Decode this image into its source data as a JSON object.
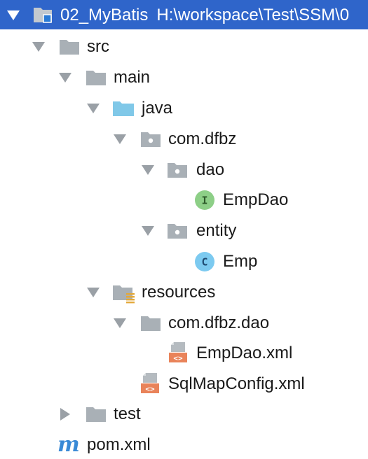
{
  "project_tree": {
    "root": {
      "name": "02_MyBatis",
      "path": "H:\\workspace\\Test\\SSM\\0"
    },
    "nodes": [
      {
        "id": "src",
        "label": "src",
        "icon": "folder-icon",
        "expanded": true
      },
      {
        "id": "main",
        "label": "main",
        "icon": "folder-icon",
        "expanded": true
      },
      {
        "id": "java",
        "label": "java",
        "icon": "source-folder-icon",
        "expanded": true
      },
      {
        "id": "pkg-com-dfbz",
        "label": "com.dfbz",
        "icon": "package-icon",
        "expanded": true
      },
      {
        "id": "pkg-dao",
        "label": "dao",
        "icon": "package-icon",
        "expanded": true
      },
      {
        "id": "empdao",
        "label": "EmpDao",
        "icon": "interface-icon",
        "badge": "I"
      },
      {
        "id": "pkg-entity",
        "label": "entity",
        "icon": "package-icon",
        "expanded": true
      },
      {
        "id": "emp",
        "label": "Emp",
        "icon": "class-icon",
        "badge": "C"
      },
      {
        "id": "resources",
        "label": "resources",
        "icon": "resources-folder-icon",
        "expanded": true
      },
      {
        "id": "res-com-dfbz-dao",
        "label": "com.dfbz.dao",
        "icon": "folder-icon",
        "expanded": true
      },
      {
        "id": "empdao-xml",
        "label": "EmpDao.xml",
        "icon": "xml-file-icon",
        "badge": "<>"
      },
      {
        "id": "sqlmapconfig-xml",
        "label": "SqlMapConfig.xml",
        "icon": "xml-file-icon",
        "badge": "<>"
      },
      {
        "id": "test",
        "label": "test",
        "icon": "folder-icon",
        "expanded": false
      },
      {
        "id": "pom-xml",
        "label": "pom.xml",
        "icon": "maven-icon",
        "badge": "m"
      }
    ]
  },
  "colors": {
    "selection": "#2f65ca",
    "folder": "#a9b0b6",
    "source_folder": "#80c8e8",
    "interface_badge": "#8dcf87",
    "class_badge": "#7ccaf0",
    "xml_badge": "#e9835a",
    "maven": "#3a8ad6",
    "arrow": "#9aa0a6"
  }
}
